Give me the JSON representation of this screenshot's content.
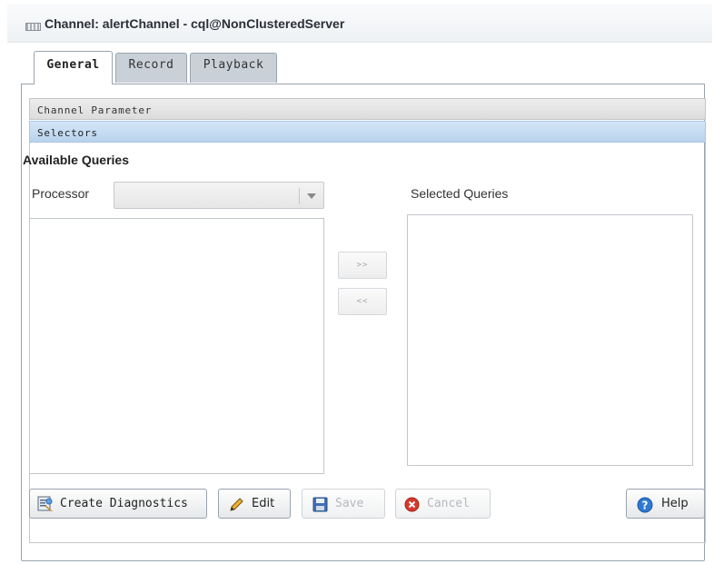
{
  "window": {
    "title": "Channel: alertChannel - cql@NonClusteredServer",
    "icon": "channel-icon"
  },
  "tabs": [
    {
      "label": "General",
      "active": true
    },
    {
      "label": "Record",
      "active": false
    },
    {
      "label": "Playback",
      "active": false
    }
  ],
  "sections": {
    "channel_parameter": "Channel Parameter",
    "selectors": "Selectors"
  },
  "available": {
    "title": "Available Queries",
    "processor_label": "Processor",
    "processor_value": ""
  },
  "selected": {
    "title": "Selected Queries"
  },
  "move_buttons": {
    "add": ">>",
    "remove": "<<"
  },
  "buttons": {
    "create_diagnostics": "Create Diagnostics",
    "edit": "Edit",
    "save": "Save",
    "cancel": "Cancel",
    "help": "Help"
  },
  "colors": {
    "accent_blue": "#2f7ad1",
    "cancel_red": "#d63a2a",
    "edit_orange": "#e08a1c"
  }
}
